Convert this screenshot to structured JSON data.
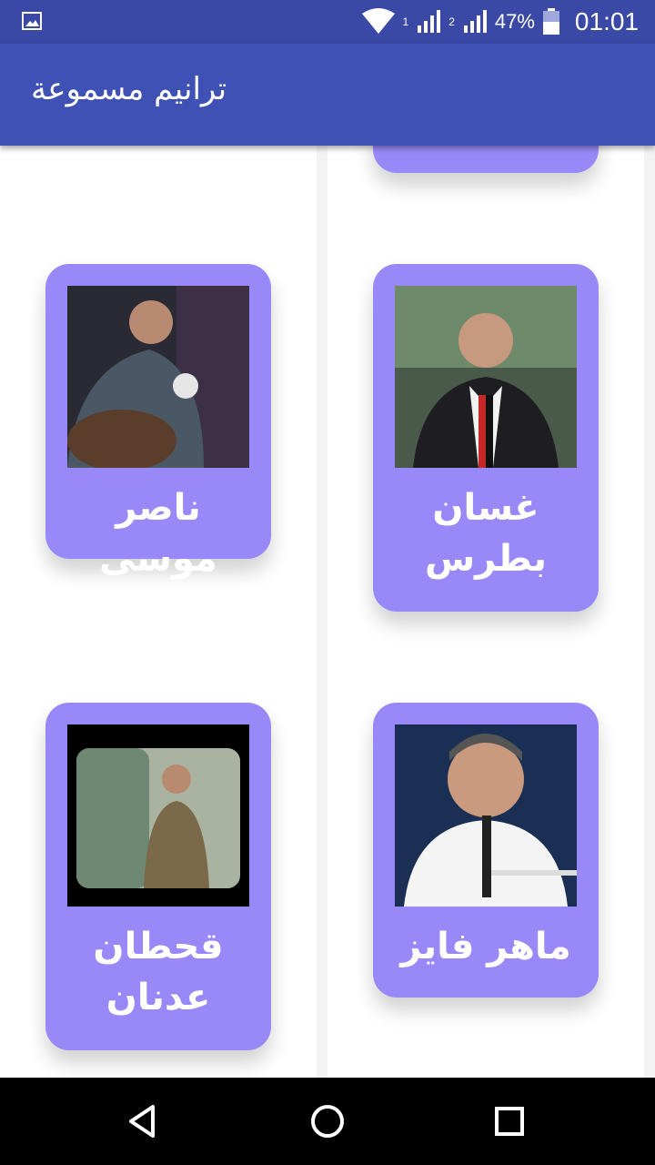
{
  "status_bar": {
    "battery": "47%",
    "time": "01:01",
    "sim1": "1",
    "sim2": "2",
    "icons": [
      "gallery-icon",
      "wifi-icon",
      "signal-icon",
      "battery-icon"
    ]
  },
  "app_bar": {
    "title": "ترانيم مسموعة"
  },
  "cards": [
    {
      "name": "غسان بطرس"
    },
    {
      "name": "ناصر موسى"
    },
    {
      "name": "ماهر فايز"
    },
    {
      "name": "قحطان عدنان"
    }
  ],
  "nav_bar": {
    "icons": [
      "back-icon",
      "home-icon",
      "recents-icon"
    ]
  },
  "colors": {
    "status_bar": "#3a49a6",
    "app_bar": "#3f51b5",
    "card": "#9988f7"
  }
}
